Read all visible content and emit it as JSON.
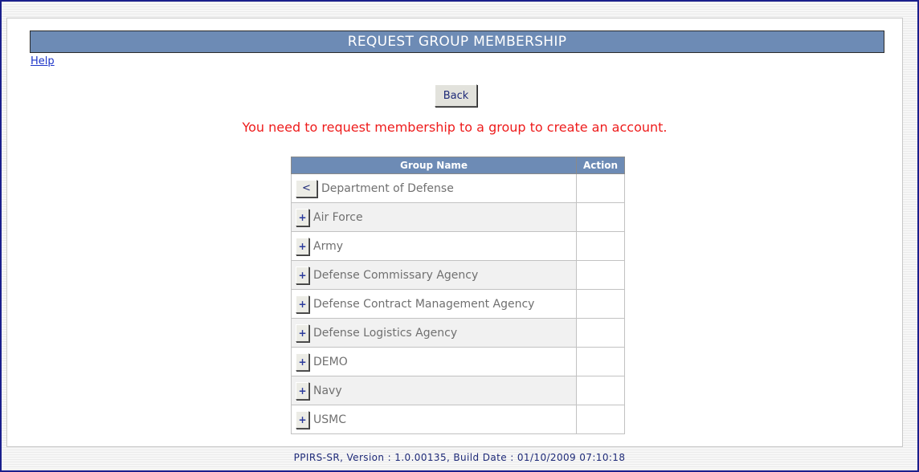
{
  "header": {
    "title": "REQUEST GROUP MEMBERSHIP"
  },
  "help_link": "Help",
  "back_button": "Back",
  "message": "You need to request membership to a group to create an account.",
  "table": {
    "columns": [
      "Group Name",
      "Action"
    ],
    "rows": [
      {
        "toggle": "<",
        "name": "Department of Defense",
        "action": ""
      },
      {
        "toggle": "+",
        "name": "Air Force",
        "action": ""
      },
      {
        "toggle": "+",
        "name": "Army",
        "action": ""
      },
      {
        "toggle": "+",
        "name": "Defense Commissary Agency",
        "action": ""
      },
      {
        "toggle": "+",
        "name": "Defense Contract Management Agency",
        "action": ""
      },
      {
        "toggle": "+",
        "name": "Defense Logistics Agency",
        "action": ""
      },
      {
        "toggle": "+",
        "name": "DEMO",
        "action": ""
      },
      {
        "toggle": "+",
        "name": "Navy",
        "action": ""
      },
      {
        "toggle": "+",
        "name": "USMC",
        "action": ""
      }
    ]
  },
  "footer": "PPIRS-SR, Version : 1.0.00135, Build Date : 01/10/2009 07:10:18",
  "colors": {
    "header_bg": "#6d8bb5",
    "message": "#ee1c1c",
    "link": "#1c34c8",
    "frame_border": "#1a1f8c"
  }
}
